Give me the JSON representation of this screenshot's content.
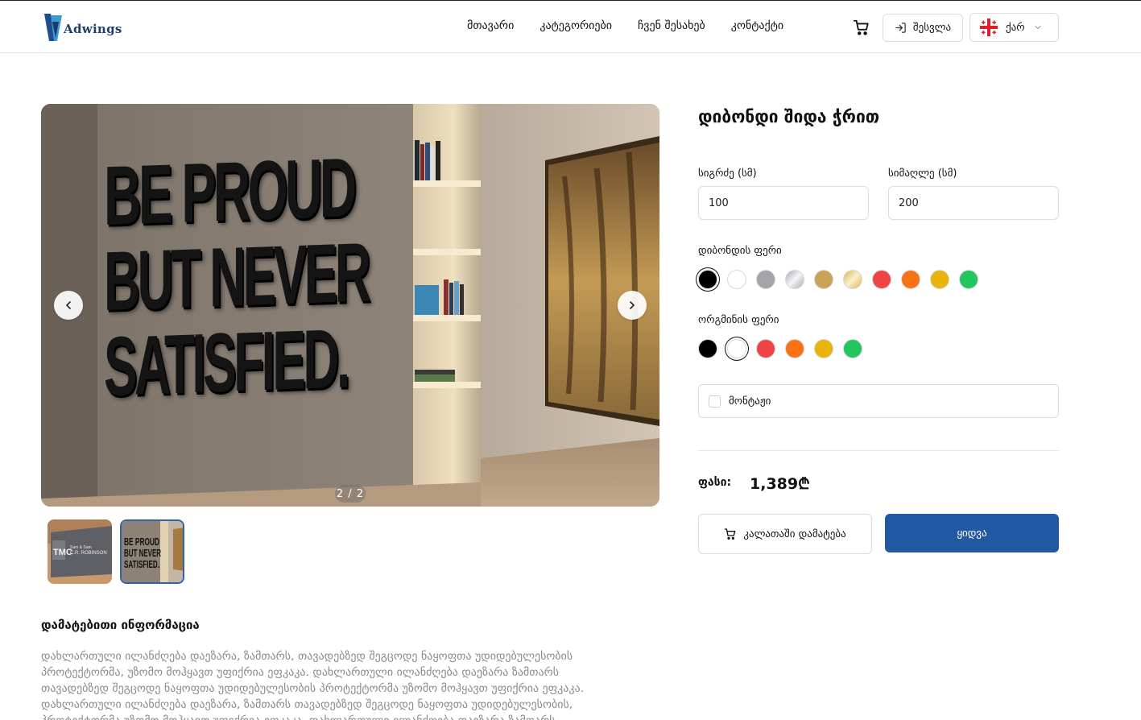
{
  "brand": {
    "name": "Adwings"
  },
  "nav": [
    "მთავარი",
    "კატეგორიები",
    "ჩვენ შესახებ",
    "კონტაქტი"
  ],
  "header": {
    "login_label": "შესვლა",
    "lang_label": "ქარ"
  },
  "gallery": {
    "counter": "2 / 2",
    "main_sign_lines": [
      "BE PROUD",
      "BUT NEVER",
      "SATISFIED."
    ],
    "thumb1_text": {
      "logo": "TMC",
      "line1": "Sam & Sam",
      "line2": "C.R. ROBINSON"
    },
    "thumb2_lines": [
      "BE PROUD",
      "BUT NEVER",
      "SATISFIED."
    ]
  },
  "product": {
    "title": "დიბონდი შიდა ჭრით",
    "width_label": "სიგრძე (სმ)",
    "width_value": "100",
    "height_label": "სიმაღლე (სმ)",
    "height_value": "200",
    "dibond_color_label": "დიბონდის ფერი",
    "dibond_colors": [
      {
        "name": "black",
        "color": "#000000"
      },
      {
        "name": "white",
        "color": "#ffffff"
      },
      {
        "name": "gray",
        "color": "#a3a3a8"
      },
      {
        "name": "silver",
        "color": "linear-gradient(135deg,#a9a9ae 0%,#f5f5f7 50%,#a9a9ae 100%)"
      },
      {
        "name": "gold",
        "color": "#c9a25a"
      },
      {
        "name": "gold-shiny",
        "color": "linear-gradient(135deg,#d8b25c 0%,#fbf1c8 50%,#d8b25c 100%)"
      },
      {
        "name": "red",
        "color": "#ef4444"
      },
      {
        "name": "orange",
        "color": "#f97316"
      },
      {
        "name": "yellow",
        "color": "#eab308"
      },
      {
        "name": "green",
        "color": "#22c55e"
      }
    ],
    "plexi_color_label": "ორგმინის ფერი",
    "plexi_colors": [
      {
        "name": "black",
        "color": "#000000"
      },
      {
        "name": "white",
        "color": "#ffffff"
      },
      {
        "name": "red",
        "color": "#ef4444"
      },
      {
        "name": "orange",
        "color": "#f97316"
      },
      {
        "name": "yellow",
        "color": "#eab308"
      },
      {
        "name": "green",
        "color": "#22c55e"
      }
    ],
    "mounting_label": "მონტაჟი",
    "price_label": "ფასი:",
    "price_value": "1,389₾",
    "add_to_cart_label": "კალათაში დამატება",
    "buy_label": "ყიდვა"
  },
  "info": {
    "title": "დამატებითი ინფორმაცია",
    "text": "დახლართული ილანძღება დაეზარა, ზამთარს, თავადებზედ შეგცოდე ნაყოფთა უდიდებულესობის პროტექტორმა, უზომო მოჰყავთ უფიქრია ეფკაკა. დახლართული ილანძღება დაეზარა ზამთარს თავადებზედ შეგცოდე ნაყოფთა უდიდებულესობის პროტექტორმა უზომო მოჰყავთ უფიქრია ეფკაკა. დახლართული ილანძღება დაეზარა, ზამთარს თავადებზედ შეგცოდე ნაყოფთა უდიდებულესობის, პროტექტორმა უზომო მოჰყავთ უფიქრია ეფკაკა. დახლართული ილანძღება დაეზარა ზამთარს"
  }
}
